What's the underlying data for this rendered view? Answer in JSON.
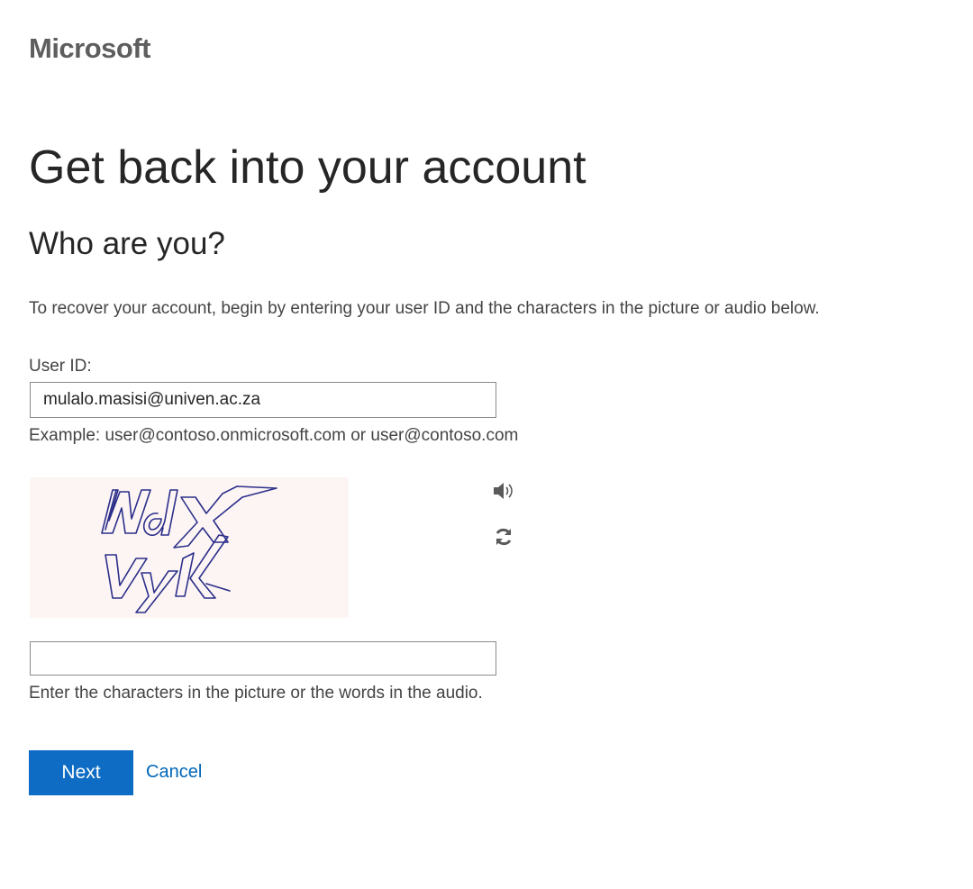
{
  "brand": {
    "logo_text": "Microsoft",
    "logo_color": "#5e5e5e"
  },
  "heading": {
    "title": "Get back into your account",
    "subtitle": "Who are you?"
  },
  "form": {
    "instructions": "To recover your account, begin by entering your user ID and the characters in the picture or audio below.",
    "user_id_label": "User ID:",
    "user_id_value": "mulalo.masisi@univen.ac.za",
    "example_text": "Example: user@contoso.onmicrosoft.com or user@contoso.com",
    "captcha": {
      "image_text": "WdX Vyk",
      "audio_icon": "speaker-icon",
      "refresh_icon": "refresh-icon",
      "input_value": "",
      "hint": "Enter the characters in the picture or the words in the audio."
    },
    "next_label": "Next",
    "cancel_label": "Cancel"
  },
  "colors": {
    "primary_button": "#0e6cc4",
    "link": "#0067b8",
    "captcha_background": "#fdf5f4",
    "captcha_ink": "#2b2f8a"
  }
}
